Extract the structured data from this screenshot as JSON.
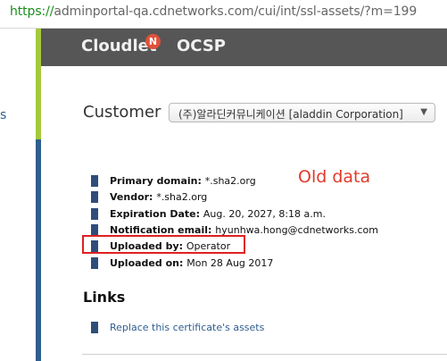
{
  "browser": {
    "url_scheme": "https://",
    "url_rest": "adminportal-qa.cdnetworks.com/cui/int/ssl-assets/?m=199"
  },
  "left_partial": "s",
  "header": {
    "brand": "Cloudlet",
    "brand_badge": "N",
    "nav_item": "OCSP"
  },
  "customer": {
    "label": "Customer",
    "selected": "(주)알라딘커뮤니케이션 [aladdin Corporation]"
  },
  "annotation": {
    "old_data": "Old data"
  },
  "details": [
    {
      "label": "Primary domain:",
      "value": "*.sha2.org"
    },
    {
      "label": "Vendor:",
      "value": "*.sha2.org"
    },
    {
      "label": "Expiration Date:",
      "value": "Aug. 20, 2027, 8:18 a.m."
    },
    {
      "label": "Notification email:",
      "value": "hyunhwa.hong@cdnetworks.com"
    },
    {
      "label": "Uploaded by:",
      "value": "Operator"
    },
    {
      "label": "Uploaded on:",
      "value": "Mon 28 Aug 2017"
    }
  ],
  "links": {
    "title": "Links",
    "items": [
      "Replace this certificate's assets"
    ]
  },
  "colors": {
    "header_bg": "#565656",
    "accent_blue": "#2e5f8e",
    "accent_lime": "#a4c93c",
    "annotation_red": "#e23a2a",
    "link_color": "#2e5d8e"
  }
}
